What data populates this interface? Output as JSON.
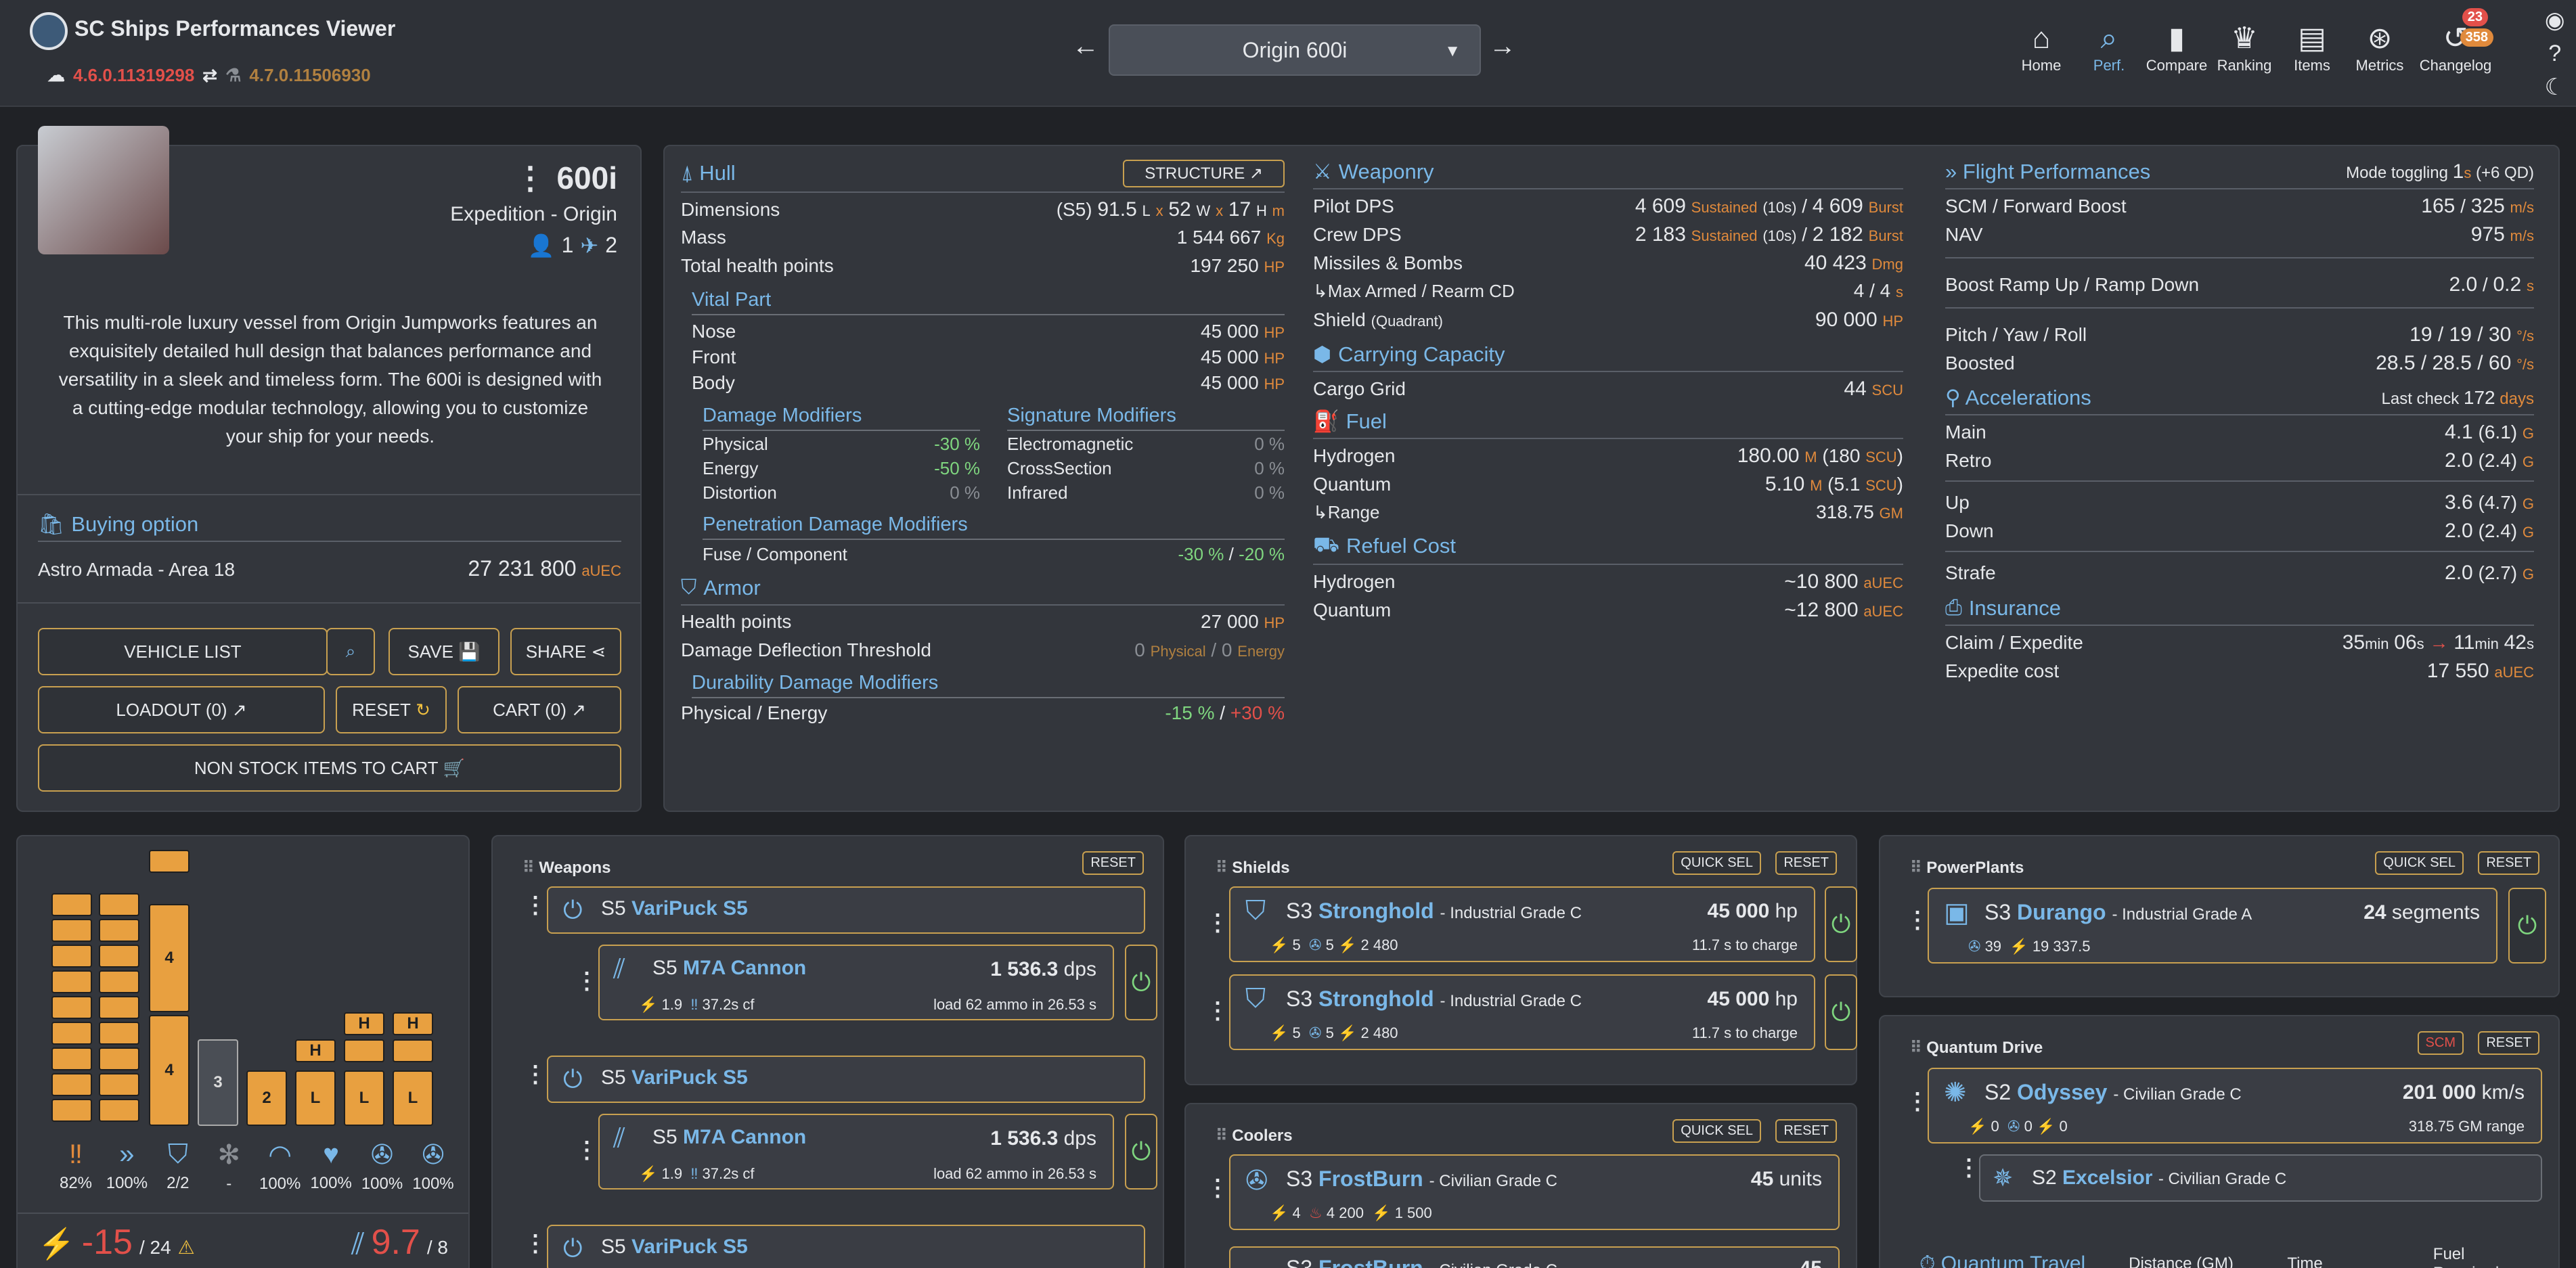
{
  "app": {
    "title": "SC Ships Performances Viewer",
    "version_live": "4.6.0.11319298",
    "version_ptu": "4.7.0.11506930"
  },
  "ship_selector": {
    "value": "Origin 600i"
  },
  "nav": [
    {
      "label": "Home",
      "icon": "home-icon"
    },
    {
      "label": "Perf.",
      "icon": "search-icon"
    },
    {
      "label": "Compare",
      "icon": "bar-chart-icon"
    },
    {
      "label": "Ranking",
      "icon": "trophy-icon"
    },
    {
      "label": "Items",
      "icon": "items-icon"
    },
    {
      "label": "Metrics",
      "icon": "metrics-icon"
    },
    {
      "label": "Changelog",
      "icon": "history-icon"
    }
  ],
  "badges": {
    "changelog_top": "23",
    "changelog_bottom": "358"
  },
  "ship": {
    "name": "600i",
    "role": "Expedition - Origin",
    "crew_min": "1",
    "crew_max": "2",
    "description": "This multi-role luxury vessel from Origin Jumpworks features an exquisitely detailed hull design that balances performance and versatility in a sleek and timeless form. The 600i is designed with a cutting-edge modular technology, allowing you to customize your ship for your needs."
  },
  "buying": {
    "title": "Buying option",
    "location": "Astro Armada - Area 18",
    "price": "27 231 800",
    "currency": "aUEC"
  },
  "buttons": {
    "vehicle_list": "VEHICLE LIST",
    "save": "SAVE",
    "share": "SHARE",
    "loadout": "LOADOUT (0)",
    "reset": "RESET",
    "cart": "CART (0)",
    "non_stock": "NON STOCK ITEMS TO CART"
  },
  "hull": {
    "title": "Hull",
    "structure_btn": "STRUCTURE",
    "dim_label": "Dimensions",
    "dim_size": "(S5)",
    "dim_l": "91.5",
    "dim_w": "52",
    "dim_h": "17",
    "mass_label": "Mass",
    "mass": "1 544 667",
    "mass_unit": "Kg",
    "thp_label": "Total health points",
    "thp": "197 250",
    "hp_unit": "HP",
    "vital_title": "Vital Part",
    "vital": [
      {
        "label": "Nose",
        "value": "45 000"
      },
      {
        "label": "Front",
        "value": "45 000"
      },
      {
        "label": "Body",
        "value": "45 000"
      }
    ],
    "dmg_mod_title": "Damage Modifiers",
    "dmg_mods": [
      {
        "label": "Physical",
        "value": "-30 %"
      },
      {
        "label": "Energy",
        "value": "-50 %"
      },
      {
        "label": "Distortion",
        "value": "0 %"
      }
    ],
    "sig_mod_title": "Signature Modifiers",
    "sig_mods": [
      {
        "label": "Electromagnetic",
        "value": "0 %"
      },
      {
        "label": "CrossSection",
        "value": "0 %"
      },
      {
        "label": "Infrared",
        "value": "0 %"
      }
    ],
    "pen_title": "Penetration Damage Modifiers",
    "pen_label": "Fuse / Component",
    "pen_fuse": "-30 %",
    "pen_comp": "-20 %"
  },
  "armor": {
    "title": "Armor",
    "hp_label": "Health points",
    "hp": "27 000",
    "ddt_label": "Damage Deflection Threshold",
    "ddt_phys": "0",
    "ddt_energy": "0",
    "phys_word": "Physical",
    "energy_word": "Energy",
    "dur_title": "Durability Damage Modifiers",
    "dur_label": "Physical / Energy",
    "dur_phys": "-15 %",
    "dur_energy": "+30 %"
  },
  "weaponry": {
    "title": "Weaponry",
    "pilot_label": "Pilot DPS",
    "pilot_sust": "4 609",
    "pilot_burst": "4 609",
    "crew_label": "Crew DPS",
    "crew_sust": "2 183",
    "crew_burst": "2 182",
    "sustained": "Sustained",
    "ten_s": "(10s)",
    "burst": "Burst",
    "missiles_label": "Missiles & Bombs",
    "missiles": "40 423",
    "dmg_unit": "Dmg",
    "max_armed_label": "↳Max Armed / Rearm CD",
    "max_armed": "4 / 4",
    "shield_label": "Shield",
    "shield_sub": "(Quadrant)",
    "shield": "90 000"
  },
  "carrying": {
    "title": "Carrying Capacity",
    "cargo_label": "Cargo Grid",
    "cargo": "44",
    "cargo_unit": "SCU"
  },
  "fuel": {
    "title": "Fuel",
    "h_label": "Hydrogen",
    "h": "180.00",
    "h_scu": "180",
    "q_label": "Quantum",
    "q": "5.10",
    "q_scu": "5.1",
    "range_label": "↳Range",
    "range": "318.75",
    "range_unit": "GM"
  },
  "refuel": {
    "title": "Refuel Cost",
    "h_label": "Hydrogen",
    "h": "~10 800",
    "q_label": "Quantum",
    "q": "~12 800",
    "unit": "aUEC"
  },
  "flight": {
    "title": "Flight Performances",
    "mode_label": "Mode toggling",
    "mode_val": "1",
    "mode_extra": "(+6 QD)",
    "scm_label": "SCM / Forward Boost",
    "scm": "165",
    "boost": "325",
    "nav_label": "NAV",
    "nav": "975",
    "speed_unit": "m/s",
    "ramp_label": "Boost Ramp Up / Ramp Down",
    "ramp_up": "2.0",
    "ramp_down": "0.2",
    "pyr_label": "Pitch / Yaw / Roll",
    "pyr": "19 / 19 / 30",
    "boosted_label": "Boosted",
    "boosted": "28.5 / 28.5 / 60",
    "deg_unit": "°/s"
  },
  "accel": {
    "title": "Accelerations",
    "last_check": "Last check",
    "days": "172",
    "days_unit": "days",
    "rows": [
      {
        "label": "Main",
        "value": "4.1",
        "sub": "(6.1)"
      },
      {
        "label": "Retro",
        "value": "2.0",
        "sub": "(2.4)"
      },
      {
        "label": "Up",
        "value": "3.6",
        "sub": "(4.7)"
      },
      {
        "label": "Down",
        "value": "2.0",
        "sub": "(2.4)"
      },
      {
        "label": "Strafe",
        "value": "2.0",
        "sub": "(2.7)"
      }
    ],
    "unit": "G"
  },
  "insurance": {
    "title": "Insurance",
    "claim_label": "Claim / Expedite",
    "claim_min": "35",
    "claim_s": "06",
    "exp_min": "11",
    "exp_s": "42",
    "cost_label": "Expedite cost",
    "cost": "17 550",
    "unit": "aUEC"
  },
  "power": {
    "stats": [
      {
        "icon": "ammo-icon",
        "value": "82%"
      },
      {
        "icon": "speed-icon",
        "value": "100%"
      },
      {
        "icon": "shield-icon",
        "value": "2/2"
      },
      {
        "icon": "cooler-icon",
        "value": "-"
      },
      {
        "icon": "radar-icon",
        "value": "100%"
      },
      {
        "icon": "health-icon",
        "value": "100%"
      },
      {
        "icon": "fan-icon",
        "value": "100%"
      },
      {
        "icon": "fan2-icon",
        "value": "100%"
      }
    ],
    "col_labels": [
      "4",
      "4",
      "3",
      "2",
      "H",
      "H",
      "H",
      "L",
      "L"
    ],
    "bottom_left": "-15",
    "bottom_left_max": "/ 24",
    "bottom_right": "9.7",
    "bottom_right_max": "/ 8"
  },
  "weapons": {
    "title": "Weapons",
    "reset": "RESET",
    "mount": "S5",
    "mount_name": "VariPuck S5",
    "gun_size": "S5",
    "gun_name": "M7A Cannon",
    "dps": "1 536.3",
    "dps_unit": "dps",
    "fire_rate": "1.9",
    "cf": "37.2s cf",
    "load": "load 62 ammo in 26.53 s"
  },
  "shields": {
    "title": "Shields",
    "quick": "QUICK SEL",
    "reset": "RESET",
    "items": [
      {
        "size": "S3",
        "name": "Stronghold",
        "grade": "- Industrial Grade C",
        "hp": "45 000",
        "unit": "hp",
        "charge": "11.7 s to charge",
        "pwr": "5",
        "cool": "5",
        "em": "2 480"
      },
      {
        "size": "S3",
        "name": "Stronghold",
        "grade": "- Industrial Grade C",
        "hp": "45 000",
        "unit": "hp",
        "charge": "11.7 s to charge",
        "pwr": "5",
        "cool": "5",
        "em": "2 480"
      }
    ]
  },
  "coolers": {
    "title": "Coolers",
    "quick": "QUICK SEL",
    "reset": "RESET",
    "size": "S3",
    "name": "FrostBurn",
    "grade": "- Civilian Grade C",
    "units": "45",
    "unit_word": "units",
    "pwr": "4",
    "ir": "4 200",
    "em": "1 500"
  },
  "powerplants": {
    "title": "PowerPlants",
    "quick": "QUICK SEL",
    "reset": "RESET",
    "size": "S3",
    "name": "Durango",
    "grade": "- Industrial Grade A",
    "seg": "24",
    "seg_word": "segments",
    "cool": "39",
    "em": "19 337.5"
  },
  "quantum": {
    "title": "Quantum Drive",
    "scm": "SCM",
    "reset": "RESET",
    "size": "S2",
    "name": "Odyssey",
    "grade": "- Civilian Grade C",
    "speed": "201 000",
    "speed_unit": "km/s",
    "range": "318.75 GM range",
    "pwr": "0",
    "cool": "0",
    "em": "0",
    "sub_size": "S2",
    "sub_name": "Excelsior",
    "sub_grade": "- Civilian Grade C",
    "travel_title": "Quantum Travel",
    "col_dist": "Distance (GM)",
    "col_time": "Time",
    "col_fuel": "Fuel Required"
  },
  "colors": {
    "accent": "#7ab8e8",
    "orange": "#e08a3c",
    "green": "#7fd67f",
    "red": "#e2504a",
    "border_gold": "#c8a050"
  }
}
